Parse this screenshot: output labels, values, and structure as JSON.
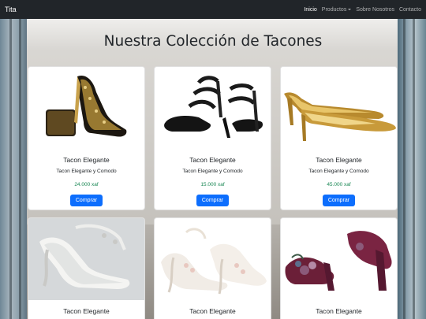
{
  "navbar": {
    "brand": "Tita",
    "links": [
      {
        "label": "Inicio",
        "active": true
      },
      {
        "label": "Productos",
        "dropdown": true
      },
      {
        "label": "Sobre Nosotros"
      },
      {
        "label": "Contacto"
      }
    ]
  },
  "page": {
    "title": "Nuestra Colección de Tacones"
  },
  "products": [
    {
      "image_icon": "gold-studded-pump-with-clutch",
      "title": "Tacon Elegante",
      "description": "Tacon Elegante y Comodo",
      "price": "24.000 xaf",
      "button": "Comprar"
    },
    {
      "image_icon": "black-strappy-sandal-heel",
      "title": "Tacon Elegante",
      "description": "Tacon Elegante y Comodo",
      "price": "15.000 xaf",
      "button": "Comprar"
    },
    {
      "image_icon": "gold-pointed-pump-pair",
      "title": "Tacon Elegante",
      "description": "Tacon Elegante y Comodo",
      "price": "45.000 xaf",
      "button": "Comprar"
    },
    {
      "image_icon": "white-ornate-bridal-heel",
      "title": "Tacon Elegante"
    },
    {
      "image_icon": "white-floral-lace-heel",
      "title": "Tacon Elegante"
    },
    {
      "image_icon": "burgundy-floral-block-heel",
      "title": "Tacon Elegante"
    }
  ],
  "colors": {
    "navbar_bg": "#212529",
    "button_primary": "#0d6efd",
    "price_green": "#198754"
  }
}
